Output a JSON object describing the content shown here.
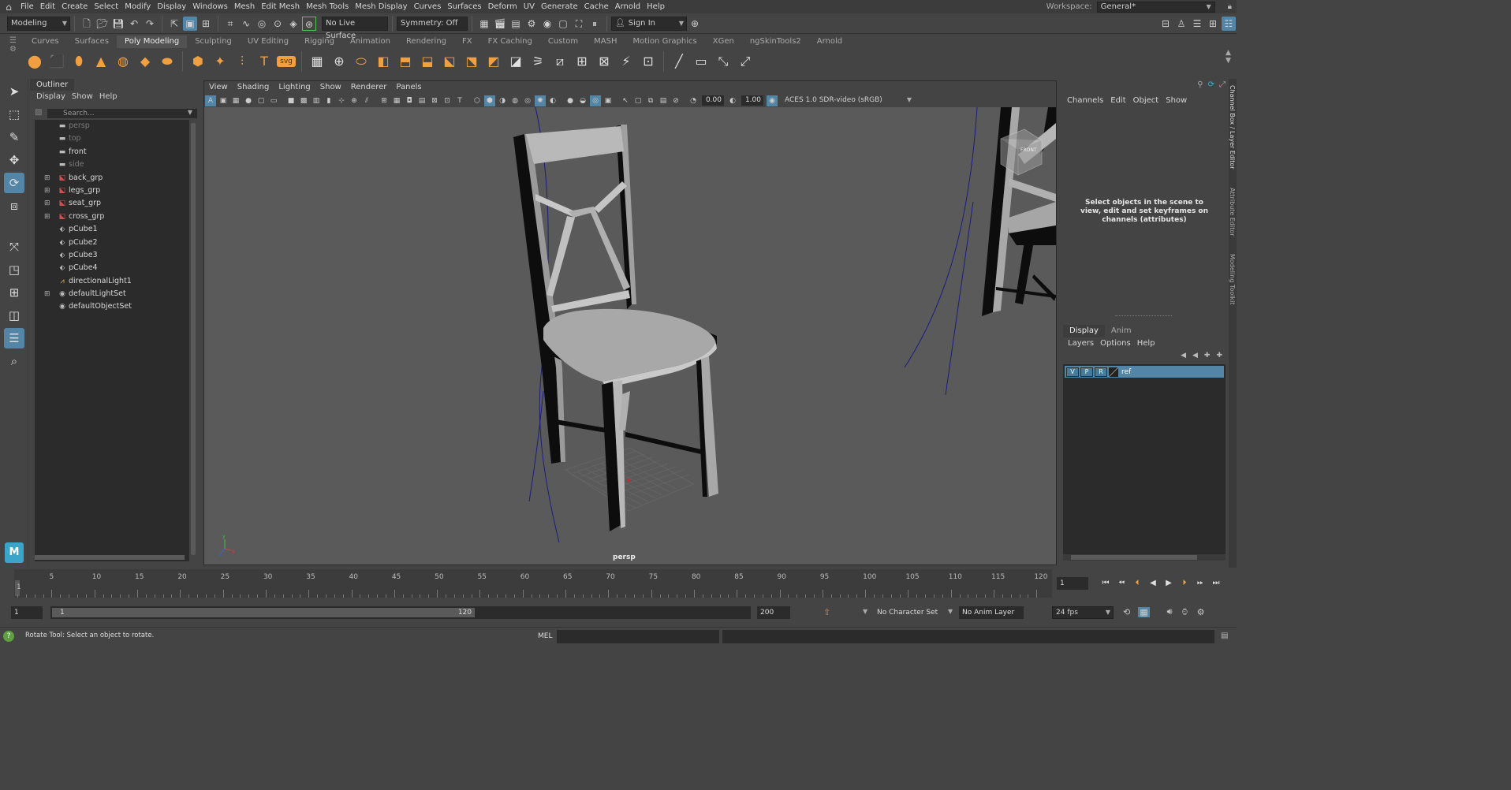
{
  "menubar": {
    "items": [
      "File",
      "Edit",
      "Create",
      "Select",
      "Modify",
      "Display",
      "Windows",
      "Mesh",
      "Edit Mesh",
      "Mesh Tools",
      "Mesh Display",
      "Curves",
      "Surfaces",
      "Deform",
      "UV",
      "Generate",
      "Cache",
      "Arnold",
      "Help"
    ],
    "workspace_label": "Workspace:",
    "workspace_value": "General*"
  },
  "statusline": {
    "mode": "Modeling",
    "live_surface": "No Live Surface",
    "symmetry": "Symmetry: Off",
    "sign_in": "Sign In"
  },
  "shelf": {
    "tabs": [
      "Curves",
      "Surfaces",
      "Poly Modeling",
      "Sculpting",
      "UV Editing",
      "Rigging",
      "Animation",
      "Rendering",
      "FX",
      "FX Caching",
      "Custom",
      "MASH",
      "Motion Graphics",
      "XGen",
      "ngSkinTools2",
      "Arnold"
    ],
    "active_tab": "Poly Modeling",
    "icons": [
      "sphere-icon",
      "cube-icon",
      "cylinder-icon",
      "cone-icon",
      "torus-icon",
      "plane-icon",
      "disc-icon",
      "platonic-icon",
      "super-shape-icon",
      "sweep-icon",
      "type-icon",
      "svg-icon",
      "combine-icon",
      "separate-icon",
      "smooth-icon",
      "boolean-icon",
      "bevel-icon",
      "bridge-icon",
      "extrude-icon",
      "append-icon",
      "merge-icon",
      "insert-edge-loop-icon",
      "offset-loop-icon",
      "multi-cut-icon",
      "target-weld-icon",
      "connect-icon",
      "fill-hole-icon",
      "mirror-icon",
      "planar-uv-icon",
      "auto-uv-icon",
      "uv-editor-icon",
      "quad-draw-icon"
    ],
    "svg_label": "svg"
  },
  "toolbox": {
    "tools": [
      "select-tool-icon",
      "lasso-tool-icon",
      "paint-select-icon",
      "move-tool-icon",
      "rotate-tool-icon",
      "scale-tool-icon",
      "show-manipulator-icon",
      "single-view-icon",
      "four-view-icon",
      "two-view-icon",
      "outliner-layout-icon",
      "search-icon"
    ],
    "logo": "M"
  },
  "outliner": {
    "title": "Outliner",
    "menu": [
      "Display",
      "Show",
      "Help"
    ],
    "search_placeholder": "Search...",
    "items": [
      {
        "label": "persp",
        "icon": "camera-icon",
        "dim": true,
        "expand": false
      },
      {
        "label": "top",
        "icon": "camera-icon",
        "dim": true,
        "expand": false
      },
      {
        "label": "front",
        "icon": "camera-icon",
        "dim": false,
        "expand": false
      },
      {
        "label": "side",
        "icon": "camera-icon",
        "dim": true,
        "expand": false
      },
      {
        "label": "back_grp",
        "icon": "group-icon",
        "dim": false,
        "expand": true
      },
      {
        "label": "legs_grp",
        "icon": "group-icon",
        "dim": false,
        "expand": true
      },
      {
        "label": "seat_grp",
        "icon": "group-icon",
        "dim": false,
        "expand": true
      },
      {
        "label": "cross_grp",
        "icon": "group-icon",
        "dim": false,
        "expand": true
      },
      {
        "label": "pCube1",
        "icon": "mesh-icon",
        "dim": false,
        "expand": false
      },
      {
        "label": "pCube2",
        "icon": "mesh-icon",
        "dim": false,
        "expand": false
      },
      {
        "label": "pCube3",
        "icon": "mesh-icon",
        "dim": false,
        "expand": false
      },
      {
        "label": "pCube4",
        "icon": "mesh-icon",
        "dim": false,
        "expand": false
      },
      {
        "label": "directionalLight1",
        "icon": "light-icon",
        "dim": false,
        "expand": false
      },
      {
        "label": "defaultLightSet",
        "icon": "set-icon",
        "dim": false,
        "expand": true
      },
      {
        "label": "defaultObjectSet",
        "icon": "set-icon",
        "dim": false,
        "expand": false
      }
    ]
  },
  "viewport": {
    "menu": [
      "View",
      "Shading",
      "Lighting",
      "Show",
      "Renderer",
      "Panels"
    ],
    "exposure": "0.00",
    "gamma": "1.00",
    "color_space": "ACES 1.0 SDR-video (sRGB)",
    "camera_label": "persp",
    "viewcube_label": "FRONT"
  },
  "channelbox": {
    "menu": [
      "Channels",
      "Edit",
      "Object",
      "Show"
    ],
    "message": "Select objects in the scene to view, edit and set keyframes on channels (attributes)",
    "layer_tabs": [
      "Display",
      "Anim"
    ],
    "layer_menu": [
      "Layers",
      "Options",
      "Help"
    ],
    "layer": {
      "v": "V",
      "p": "P",
      "r": "R",
      "name": "ref"
    },
    "side_tabs": [
      "Channel Box / Layer Editor",
      "Attribute Editor",
      "Modeling Toolkit"
    ]
  },
  "timeslider": {
    "ticks": [
      "5",
      "10",
      "15",
      "20",
      "25",
      "30",
      "35",
      "40",
      "45",
      "50",
      "55",
      "60",
      "65",
      "70",
      "75",
      "80",
      "85",
      "90",
      "95",
      "100",
      "105",
      "110",
      "115",
      "120"
    ],
    "current_frame_label": "1",
    "current_frame": "1"
  },
  "rangeslider": {
    "start": "1",
    "inner_start": "1",
    "inner_end": "120",
    "end": "200",
    "character_set": "No Character Set",
    "anim_layer": "No Anim Layer",
    "fps": "24 fps"
  },
  "cmdline": {
    "help": "Rotate Tool: Select an object to rotate.",
    "mel": "MEL"
  },
  "colors": {
    "accent": "#5285a6",
    "orange_icon": "#f0a040",
    "bg": "#444444",
    "field": "#2b2b2b"
  }
}
